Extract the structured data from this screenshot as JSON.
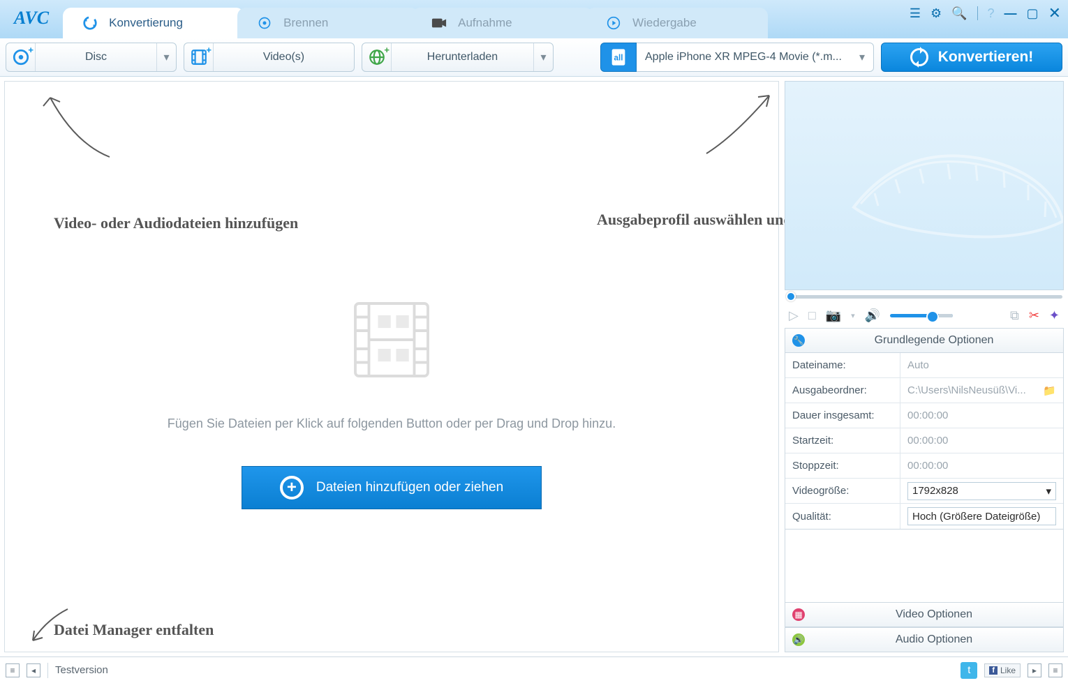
{
  "app": {
    "logo": "AVC"
  },
  "tabs": {
    "convert": "Konvertierung",
    "burn": "Brennen",
    "record": "Aufnahme",
    "play": "Wiedergabe"
  },
  "toolbar": {
    "disc": "Disc",
    "videos": "Video(s)",
    "download": "Herunterladen",
    "profile": "Apple iPhone XR MPEG-4 Movie (*.m...",
    "convert": "Konvertieren!"
  },
  "hints": {
    "add": "Video- oder Audiodateien hinzufügen",
    "profile": "Ausgabeprofil auswählen und konvertieren",
    "manager": "Datei Manager entfalten",
    "drop": "Fügen Sie Dateien per Klick auf folgenden Button oder per Drag und Drop hinzu.",
    "addbtn": "Dateien hinzufügen oder ziehen"
  },
  "panels": {
    "basic": "Grundlegende Optionen",
    "video": "Video Optionen",
    "audio": "Audio Optionen"
  },
  "options": {
    "filename_k": "Dateiname:",
    "filename_v": "Auto",
    "outdir_k": "Ausgabeordner:",
    "outdir_v": "C:\\Users\\NilsNeusüß\\Vi...",
    "duration_k": "Dauer insgesamt:",
    "duration_v": "00:00:00",
    "start_k": "Startzeit:",
    "start_v": "00:00:00",
    "stop_k": "Stoppzeit:",
    "stop_v": "00:00:00",
    "size_k": "Videogröße:",
    "size_v": "1792x828",
    "quality_k": "Qualität:",
    "quality_v": "Hoch (Größere Dateigröße)"
  },
  "status": {
    "version": "Testversion",
    "like": "Like"
  }
}
